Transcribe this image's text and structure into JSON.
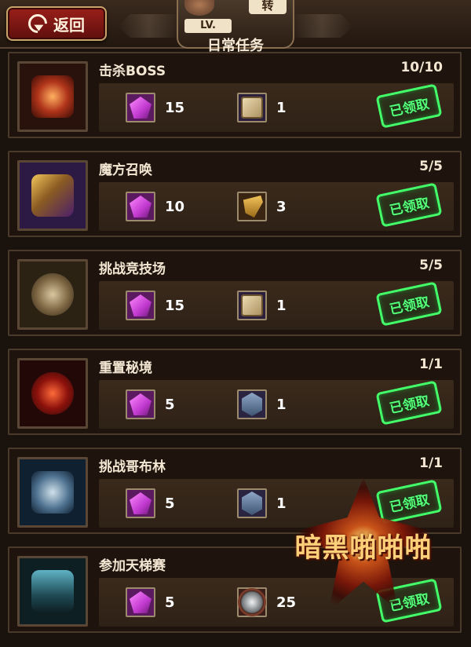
{
  "header": {
    "back_label": "返回",
    "lv_label": "LV.",
    "zhuan_label": "转",
    "title": "日常任务"
  },
  "tasks": [
    {
      "name": "击杀BOSS",
      "progress": "10/10",
      "icon": "boss-demon-icon",
      "rewards": [
        {
          "icon": "purple-gem-icon",
          "qty": "15"
        },
        {
          "icon": "dice-icon",
          "qty": "1"
        }
      ],
      "status": "已领取"
    },
    {
      "name": "魔方召唤",
      "progress": "5/5",
      "icon": "magic-cards-icon",
      "rewards": [
        {
          "icon": "purple-gem-icon",
          "qty": "10"
        },
        {
          "icon": "scroll-icon",
          "qty": "3"
        }
      ],
      "status": "已领取"
    },
    {
      "name": "挑战竞技场",
      "progress": "5/5",
      "icon": "arena-icon",
      "rewards": [
        {
          "icon": "purple-gem-icon",
          "qty": "15"
        },
        {
          "icon": "dice-icon",
          "qty": "1"
        }
      ],
      "status": "已领取"
    },
    {
      "name": "重置秘境",
      "progress": "1/1",
      "icon": "red-portal-icon",
      "rewards": [
        {
          "icon": "purple-gem-icon",
          "qty": "5"
        },
        {
          "icon": "rune-stone-icon",
          "qty": "1"
        }
      ],
      "status": "已领取"
    },
    {
      "name": "挑战哥布林",
      "progress": "1/1",
      "icon": "goblin-icon",
      "rewards": [
        {
          "icon": "purple-gem-icon",
          "qty": "5"
        },
        {
          "icon": "rune-stone-icon",
          "qty": "1"
        }
      ],
      "status": "已领取"
    },
    {
      "name": "参加天梯赛",
      "progress": "",
      "icon": "ladder-stairs-icon",
      "rewards": [
        {
          "icon": "purple-gem-icon",
          "qty": "5"
        },
        {
          "icon": "silver-medal-icon",
          "qty": "25"
        }
      ],
      "status": "已领取"
    }
  ],
  "watermark": {
    "text": "暗黑啪啪啪"
  },
  "colors": {
    "accent_green": "#56ff7a",
    "gem_purple": "#c23ad0",
    "header_red": "#9b1f1a"
  }
}
